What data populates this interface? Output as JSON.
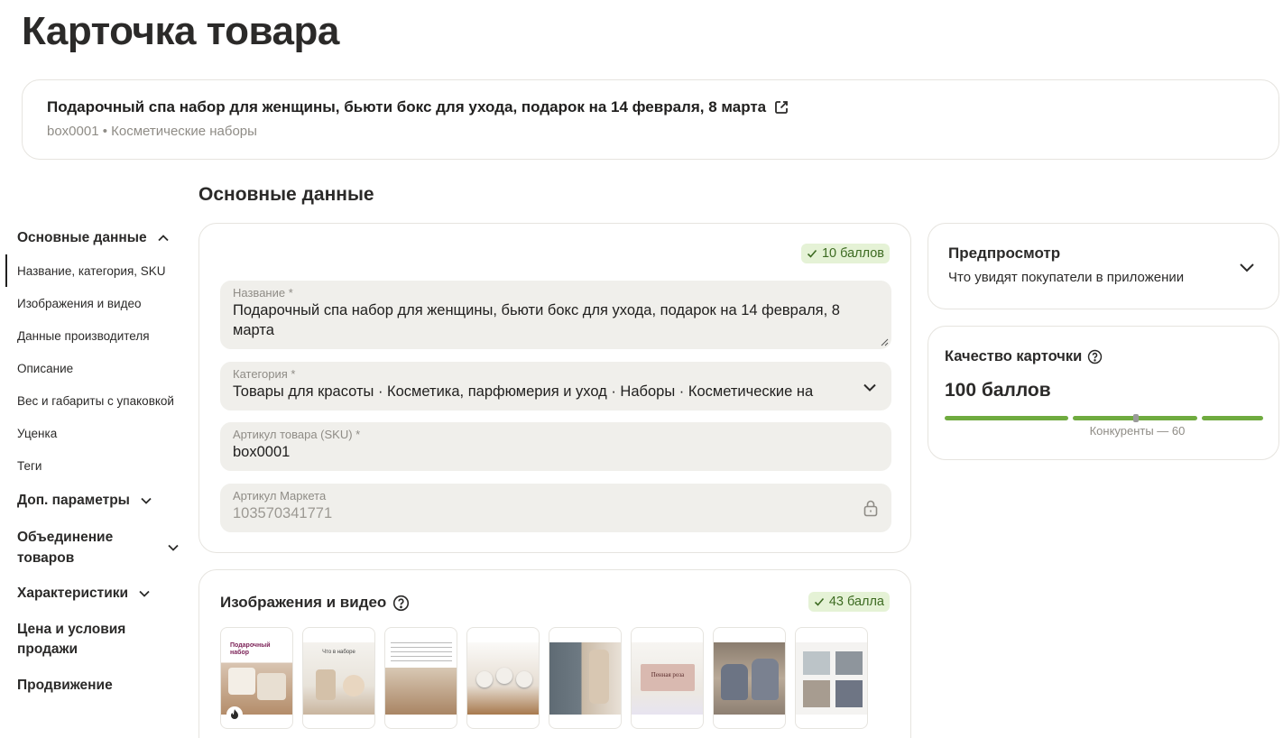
{
  "page": {
    "title": "Карточка товара"
  },
  "product": {
    "name": "Подарочный спа набор для женщины, бьюти бокс для ухода, подарок на 14 февраля, 8 марта",
    "meta": "box0001 • Косметические наборы"
  },
  "section_title": "Основные данные",
  "sidebar": {
    "groups": [
      {
        "label": "Основные данные",
        "expanded": true,
        "items": [
          "Название, категория, SKU",
          "Изображения и видео",
          "Данные производителя",
          "Описание",
          "Вес и габариты с упаковкой",
          "Уценка",
          "Теги"
        ]
      },
      {
        "label": "Доп. параметры"
      },
      {
        "label": "Объединение товаров"
      },
      {
        "label": "Характеристики"
      },
      {
        "label": "Цена и условия продажи"
      },
      {
        "label": "Продвижение"
      }
    ]
  },
  "main_card": {
    "badge": "10 баллов",
    "fields": {
      "name": {
        "label": "Название *",
        "value": "Подарочный спа набор для женщины, бьюти бокс для ухода, подарок на 14 февраля, 8 марта"
      },
      "category": {
        "label": "Категория *",
        "value": "Товары для красоты · Косметика, парфюмерия и уход · Наборы · Косметические на"
      },
      "sku": {
        "label": "Артикул товара (SKU) *",
        "value": "box0001"
      },
      "market_sku": {
        "label": "Артикул Маркета",
        "value": "103570341771"
      }
    }
  },
  "media_card": {
    "title": "Изображения и видео",
    "badge": "43 балла",
    "thumbnails": [
      {
        "icon": "gift-box-photo",
        "has_fire_badge": true,
        "caption": "Подарочный набор"
      },
      {
        "icon": "set-contents-photo",
        "caption": "Что в наборе"
      },
      {
        "icon": "jars-photo"
      },
      {
        "icon": "bath-bombs-photo"
      },
      {
        "icon": "salt-jar-photo"
      },
      {
        "icon": "handmade-soap-photo",
        "soap_text": "Пенная роза"
      },
      {
        "icon": "lavender-sachet-photo"
      },
      {
        "icon": "usage-collage-photo"
      }
    ]
  },
  "preview": {
    "title": "Предпросмотр",
    "subtitle": "Что увидят покупатели в приложении"
  },
  "quality": {
    "title": "Качество карточки",
    "score": "100 баллов",
    "score_value": 100,
    "competitors_label": "Конкуренты — 60",
    "competitors_value": 60,
    "bar_color": "#6fab3f"
  },
  "colors": {
    "badge_bg": "#e5f2d6",
    "badge_text": "#3d6b22",
    "field_bg": "#f0efeb",
    "border": "#e6e4df"
  }
}
